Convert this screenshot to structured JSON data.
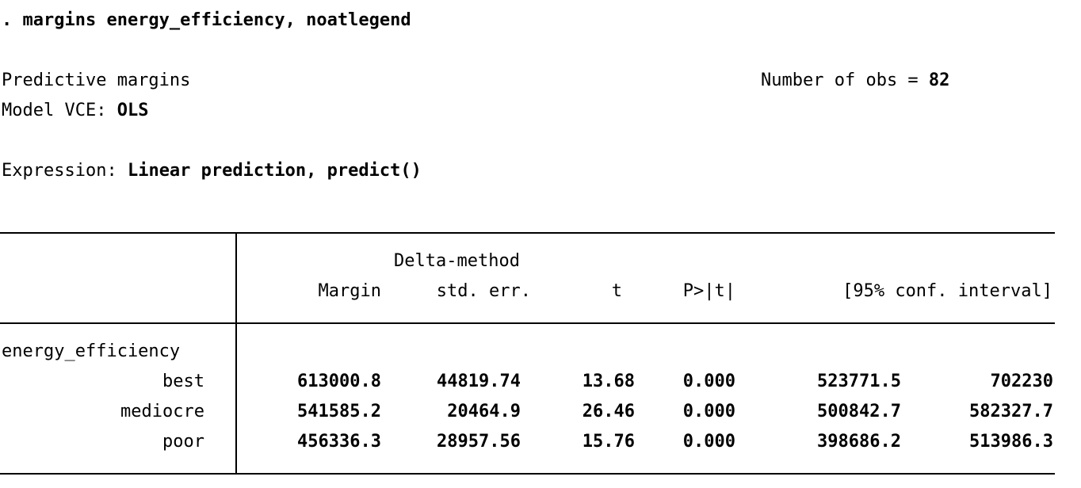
{
  "command": ". margins energy_efficiency, noatlegend",
  "header": {
    "title": "Predictive margins",
    "nobs_label": "Number of obs = ",
    "nobs_value": "82",
    "vce_label": "Model VCE: ",
    "vce_value": "OLS",
    "expression_label": "Expression: ",
    "expression_value": "Linear prediction, predict()"
  },
  "table": {
    "header_top": "Delta-method",
    "columns": [
      "Margin",
      "std. err.",
      "t",
      "P>|t|",
      "[95% conf. interval]"
    ],
    "group_label": "energy_efficiency",
    "rows": [
      {
        "label": "best",
        "margin": "613000.8",
        "se": "44819.74",
        "t": "13.68",
        "p": "0.000",
        "ci_low": "523771.5",
        "ci_high": "702230"
      },
      {
        "label": "mediocre",
        "margin": "541585.2",
        "se": "20464.9",
        "t": "26.46",
        "p": "0.000",
        "ci_low": "500842.7",
        "ci_high": "582327.7"
      },
      {
        "label": "poor",
        "margin": "456336.3",
        "se": "28957.56",
        "t": "15.76",
        "p": "0.000",
        "ci_low": "398686.2",
        "ci_high": "513986.3"
      }
    ]
  }
}
